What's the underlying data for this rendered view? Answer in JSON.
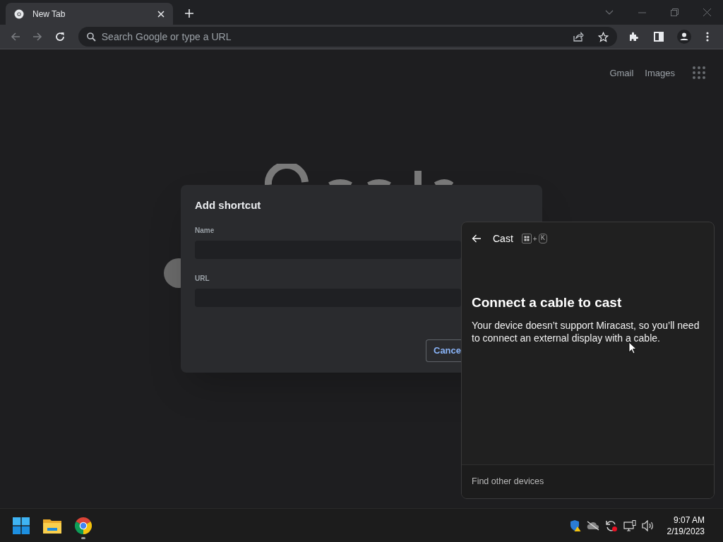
{
  "browser": {
    "tab": {
      "title": "New Tab"
    },
    "omnibox": {
      "placeholder": "Search Google or type a URL"
    },
    "header_links": [
      "Gmail",
      "Images"
    ]
  },
  "dialog": {
    "title": "Add shortcut",
    "fields": [
      {
        "label": "Name"
      },
      {
        "label": "URL"
      }
    ],
    "cancel_button": "Cance"
  },
  "cast": {
    "title": "Cast",
    "shortcut": [
      {
        "kind": "windows"
      },
      {
        "kind": "plus",
        "label": "+"
      },
      {
        "kind": "key",
        "label": "K"
      }
    ],
    "heading": "Connect a cable to cast",
    "body": "Your device doesn’t support Miracast, so you’ll need to connect an external display with a cable.",
    "footer_link": "Find other devices"
  },
  "taskbar": {
    "apps": [
      {
        "kind": "start",
        "running": false
      },
      {
        "kind": "files",
        "running": false
      },
      {
        "kind": "chrome",
        "running": true
      }
    ],
    "time": "9:07 AM",
    "date": "2/19/2023"
  }
}
